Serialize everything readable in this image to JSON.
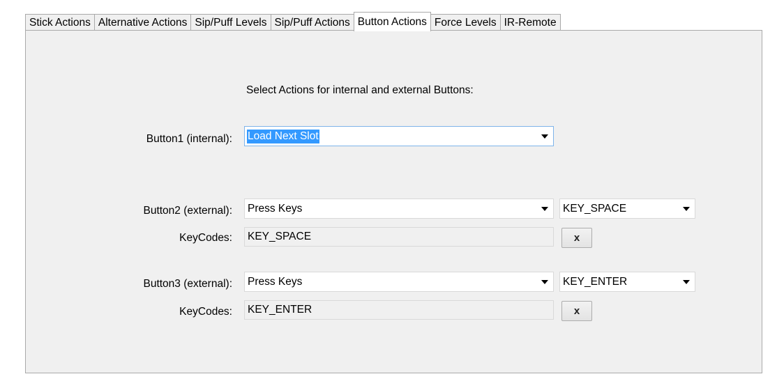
{
  "tabs": [
    {
      "label": "Stick Actions",
      "active": false
    },
    {
      "label": "Alternative Actions",
      "active": false
    },
    {
      "label": "Sip/Puff Levels",
      "active": false
    },
    {
      "label": "Sip/Puff Actions",
      "active": false
    },
    {
      "label": "Button Actions",
      "active": true
    },
    {
      "label": "Force Levels",
      "active": false
    },
    {
      "label": "IR-Remote",
      "active": false
    }
  ],
  "heading": "Select Actions for internal and external Buttons:",
  "button1": {
    "label": "Button1 (internal):",
    "action": "Load Next Slot"
  },
  "button2": {
    "label": "Button2 (external):",
    "action": "Press Keys",
    "key_select": "KEY_SPACE",
    "keycodes_label": "KeyCodes:",
    "keycodes_value": "KEY_SPACE",
    "clear_label": "x"
  },
  "button3": {
    "label": "Button3  (external):",
    "action": "Press Keys",
    "key_select": "KEY_ENTER",
    "keycodes_label": "KeyCodes:",
    "keycodes_value": "KEY_ENTER",
    "clear_label": "x"
  },
  "colors": {
    "panel_background": "#f0f0f0",
    "selection_highlight": "#3399ff",
    "focus_border": "#7eb4ea"
  },
  "icons": {
    "dropdown": "chevron-down-icon"
  }
}
